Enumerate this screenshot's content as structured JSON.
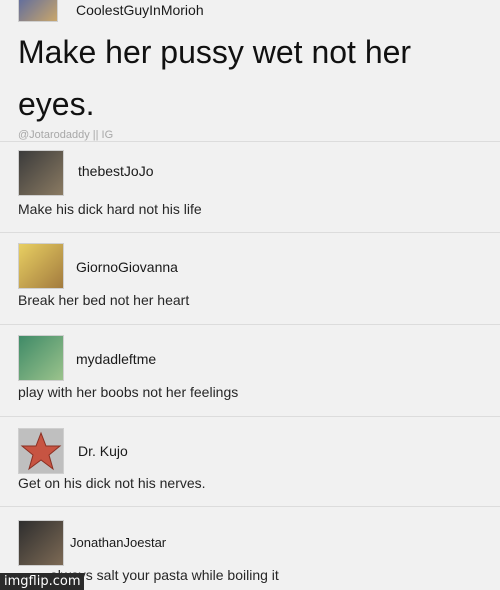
{
  "posts": [
    {
      "username": "CoolestGuyInMorioh",
      "text": "Make her pussy wet not her eyes."
    },
    {
      "username": "thebestJoJo",
      "text": "Make his dick hard not his life"
    },
    {
      "username": "GiornoGiovanna",
      "text": "Break her bed not her heart"
    },
    {
      "username": "mydadleftme",
      "text": "play with her boobs not her feelings"
    },
    {
      "username": "Dr. Kujo",
      "text": "Get on his dick not his nerves."
    },
    {
      "username": "JonathanJoestar",
      "text": "always salt your pasta while boiling it"
    }
  ],
  "watermark": "@Jotarodaddy || IG",
  "imgflip": "imgflip.com",
  "colors": {
    "background": "#f1f1f1",
    "text": "#1c1c1c",
    "divider": "#dcdcdc"
  }
}
